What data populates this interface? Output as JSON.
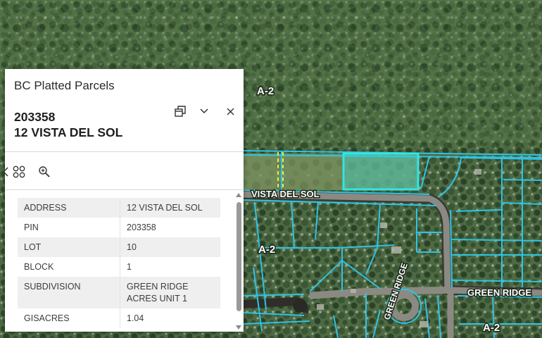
{
  "map": {
    "zone_labels": [
      "A-2",
      "A-2",
      "A-2"
    ],
    "road_labels": [
      "VISTA DEL SOL",
      "GREEN RIDGE",
      "GREEN RIDGE"
    ],
    "parcel_color": "#2ec4e6",
    "highlight_color": "#31e6e6",
    "easement_color": "#e8f03c"
  },
  "popup": {
    "layer_title": "BC Platted Parcels",
    "pin": "203358",
    "address_title": "12 VISTA DEL SOL",
    "icons": {
      "dock": "dock-icon",
      "collapse": "chevron-down-icon",
      "close": "close-icon",
      "related": "four-circles-icon",
      "zoom": "zoom-to-icon",
      "prev": "chevron-left-icon"
    },
    "attributes": [
      {
        "field": "ADDRESS",
        "value": "12 VISTA DEL SOL"
      },
      {
        "field": "PIN",
        "value": "203358"
      },
      {
        "field": "LOT",
        "value": "10"
      },
      {
        "field": "BLOCK",
        "value": "1"
      },
      {
        "field": "SUBDIVISION",
        "value": "GREEN RIDGE ACRES UNIT 1"
      },
      {
        "field": "GISACRES",
        "value": "1.04"
      }
    ]
  }
}
